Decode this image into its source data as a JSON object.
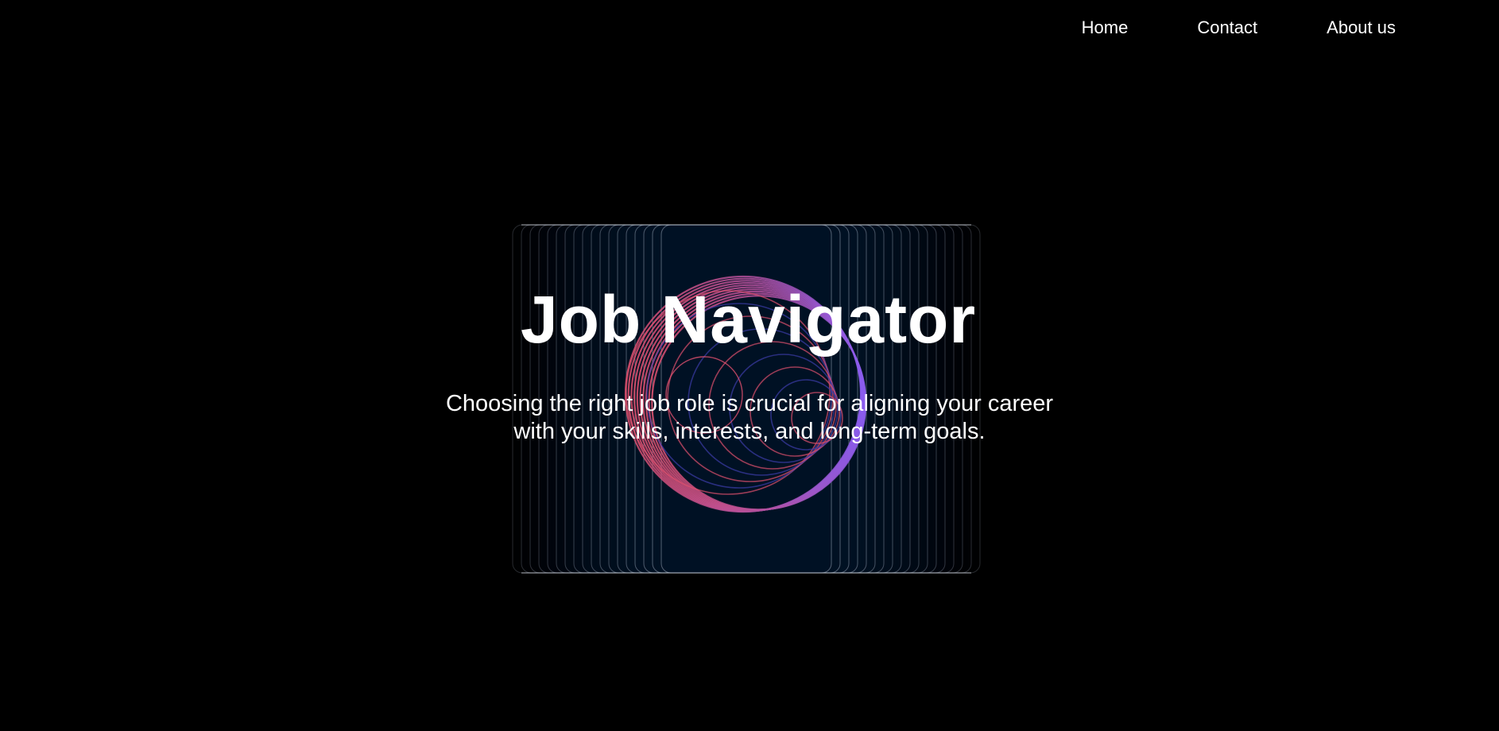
{
  "nav": {
    "items": [
      {
        "label": "Home"
      },
      {
        "label": "Contact"
      },
      {
        "label": "About us"
      }
    ]
  },
  "hero": {
    "title": "Job Navigator",
    "description": "Choosing the right job role is crucial for aligning your career with your skills, interests, and long-term goals."
  },
  "colors": {
    "background": "#000000",
    "text": "#ffffff",
    "card_fill": "#011426",
    "ring_pink": "#e0506e",
    "ring_purple": "#8a5cf0",
    "ring_blue": "#3c3ca8"
  }
}
